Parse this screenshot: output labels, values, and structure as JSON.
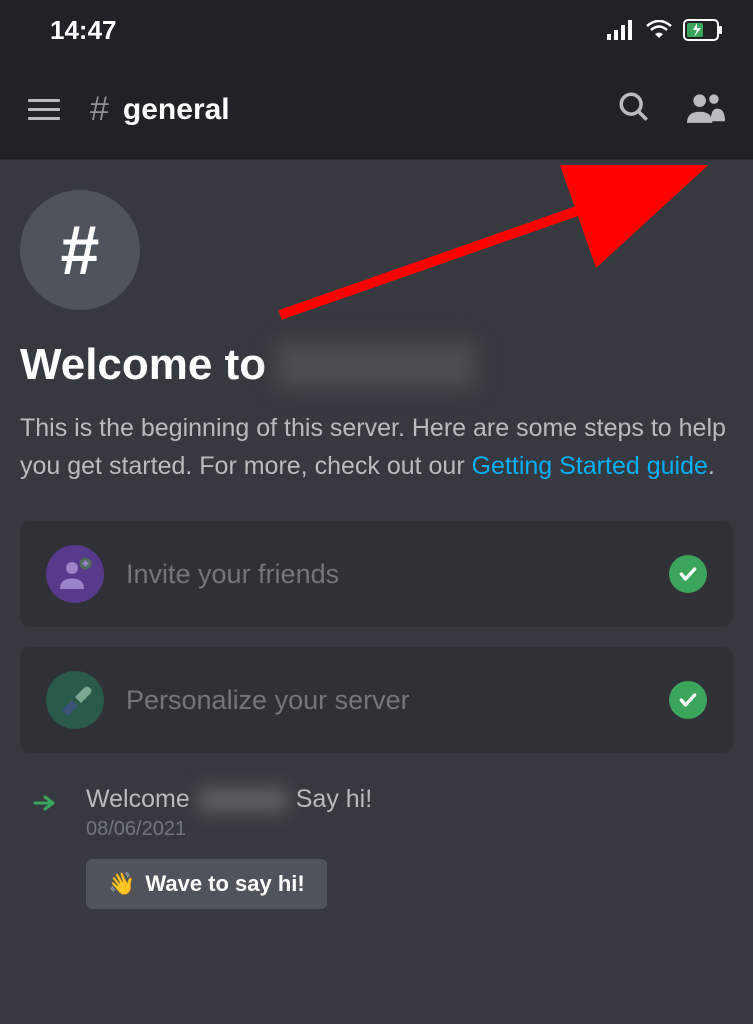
{
  "status_bar": {
    "time": "14:47"
  },
  "header": {
    "channel_name": "general"
  },
  "welcome": {
    "heading_prefix": "Welcome to",
    "description_prefix": "This is the beginning of this server. Here are some steps to help you get started. For more, check out our ",
    "link_text": "Getting Started guide",
    "description_suffix": "."
  },
  "actions": {
    "invite": {
      "label": "Invite your friends",
      "completed": true
    },
    "personalize": {
      "label": "Personalize your server",
      "completed": true
    }
  },
  "system_message": {
    "prefix": "Welcome",
    "suffix": "Say hi!",
    "date": "08/06/2021"
  },
  "wave_button": {
    "label": "Wave to say hi!"
  }
}
